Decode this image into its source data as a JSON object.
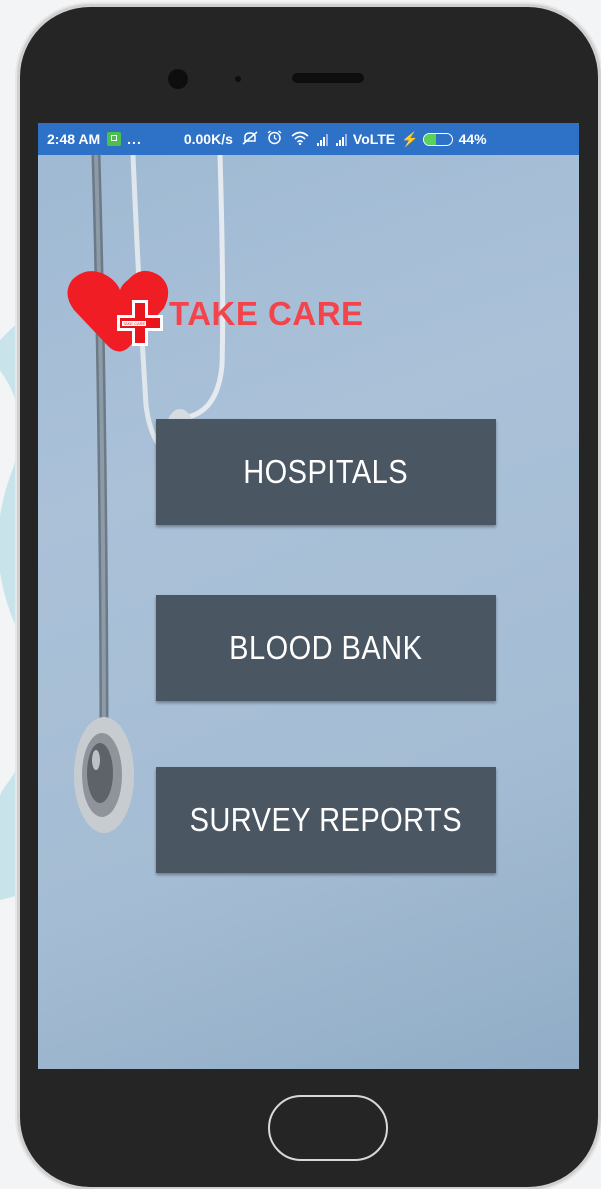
{
  "status_bar": {
    "time": "2:48 AM",
    "dots": "...",
    "speed": "0.00K/s",
    "network": "VoLTE",
    "battery_percent": "44%",
    "battery_level": 0.44,
    "bar_color": "#2e72c8",
    "icons": [
      "notification-icon",
      "mute-icon",
      "alarm-icon",
      "wifi-icon",
      "signal-icon",
      "signal-icon",
      "charging-icon",
      "battery-icon"
    ]
  },
  "app": {
    "brand": "TAKE CARE",
    "logo_text": "TAKE CARE",
    "brand_color": "#f4444b"
  },
  "menu": {
    "hospitals": "HOSPITALS",
    "blood_bank": "BLOOD BANK",
    "survey_reports": "SURVEY REPORTS",
    "button_color": "#4b5663"
  }
}
